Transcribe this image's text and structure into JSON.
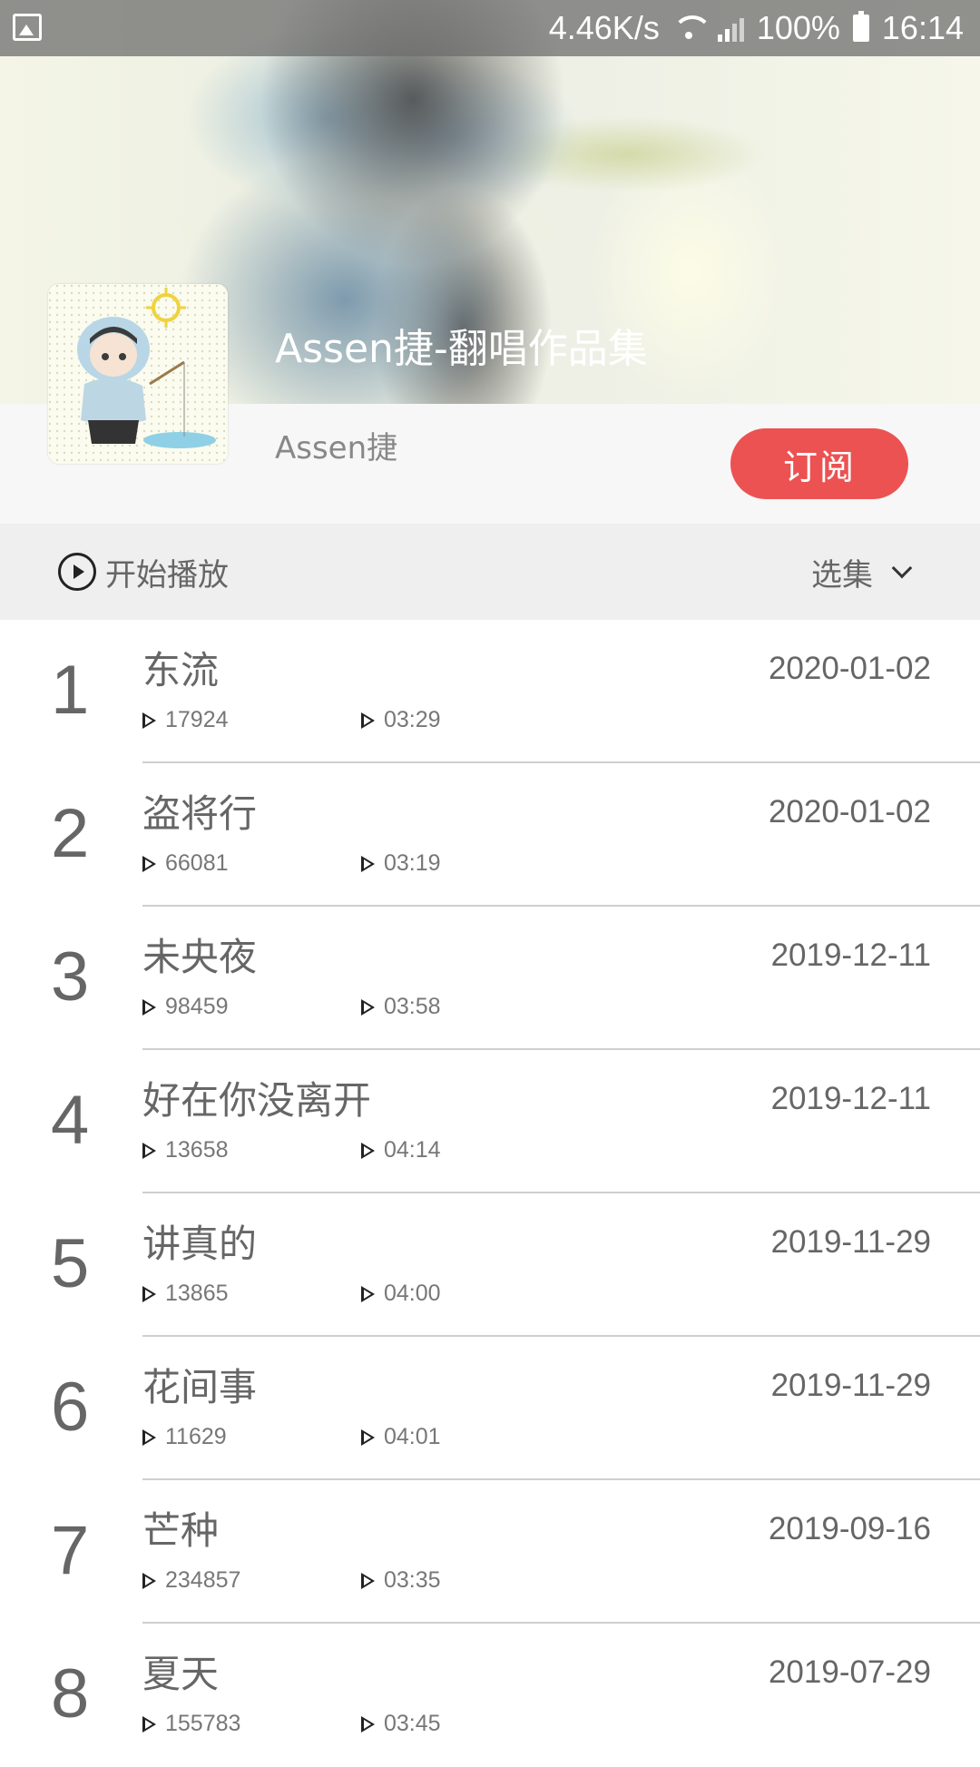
{
  "status_bar": {
    "network_speed": "4.46K/s",
    "network_type": "4G",
    "battery": "100%",
    "time": "16:14"
  },
  "album": {
    "title": "Assen捷-翻唱作品集",
    "author": "Assen捷",
    "subscribe_label": "订阅"
  },
  "controls": {
    "play_all_label": "开始播放",
    "episodes_label": "选集"
  },
  "tracks": [
    {
      "index": "1",
      "title": "东流",
      "plays": "17924",
      "duration": "03:29",
      "date": "2020-01-02"
    },
    {
      "index": "2",
      "title": "盗将行",
      "plays": "66081",
      "duration": "03:19",
      "date": "2020-01-02"
    },
    {
      "index": "3",
      "title": "未央夜",
      "plays": "98459",
      "duration": "03:58",
      "date": "2019-12-11"
    },
    {
      "index": "4",
      "title": "好在你没离开",
      "plays": "13658",
      "duration": "04:14",
      "date": "2019-12-11"
    },
    {
      "index": "5",
      "title": "讲真的",
      "plays": "13865",
      "duration": "04:00",
      "date": "2019-11-29"
    },
    {
      "index": "6",
      "title": "花间事",
      "plays": "11629",
      "duration": "04:01",
      "date": "2019-11-29"
    },
    {
      "index": "7",
      "title": "芒种",
      "plays": "234857",
      "duration": "03:35",
      "date": "2019-09-16"
    },
    {
      "index": "8",
      "title": "夏天",
      "plays": "155783",
      "duration": "03:45",
      "date": "2019-07-29"
    }
  ],
  "colors": {
    "accent": "#ec5252",
    "control_bar_bg": "#efefef",
    "text_gray": "#666666"
  }
}
